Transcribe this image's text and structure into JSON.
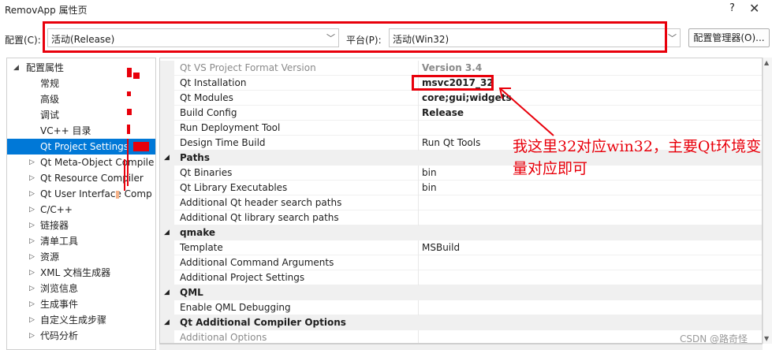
{
  "window": {
    "title": "RemovApp 属性页",
    "help": "?",
    "close": "✕"
  },
  "config_bar": {
    "config_label": "配置(C):",
    "config_value": "活动(Release)",
    "platform_label": "平台(P):",
    "platform_value": "活动(Win32)",
    "manager_button": "配置管理器(O)..."
  },
  "tree": {
    "root_label": "配置属性",
    "items": [
      {
        "label": "常规",
        "expandable": false
      },
      {
        "label": "高级",
        "expandable": false
      },
      {
        "label": "调试",
        "expandable": false
      },
      {
        "label": "VC++ 目录",
        "expandable": false
      },
      {
        "label": "Qt Project Settings",
        "expandable": false,
        "selected": true
      },
      {
        "label": "Qt Meta-Object Compile",
        "expandable": true
      },
      {
        "label": "Qt Resource Compiler",
        "expandable": true
      },
      {
        "label": "Qt User Interface Comp",
        "expandable": true
      },
      {
        "label": "C/C++",
        "expandable": true
      },
      {
        "label": "链接器",
        "expandable": true
      },
      {
        "label": "清单工具",
        "expandable": true
      },
      {
        "label": "资源",
        "expandable": true
      },
      {
        "label": "XML 文档生成器",
        "expandable": true
      },
      {
        "label": "浏览信息",
        "expandable": true
      },
      {
        "label": "生成事件",
        "expandable": true
      },
      {
        "label": "自定义生成步骤",
        "expandable": true
      },
      {
        "label": "代码分析",
        "expandable": true
      }
    ]
  },
  "grid": {
    "rows": [
      {
        "type": "prop",
        "name": "Qt VS Project Format Version",
        "value": "Version 3.4",
        "bold": true,
        "dim": true
      },
      {
        "type": "prop",
        "name": "Qt Installation",
        "value": "msvc2017_32",
        "bold": true
      },
      {
        "type": "prop",
        "name": "Qt Modules",
        "value": "core;gui;widgets",
        "bold": true
      },
      {
        "type": "prop",
        "name": "Build Config",
        "value": "Release",
        "bold": true
      },
      {
        "type": "prop",
        "name": "Run Deployment Tool",
        "value": ""
      },
      {
        "type": "prop",
        "name": "Design Time Build",
        "value": "Run Qt Tools"
      },
      {
        "type": "cat",
        "name": "Paths"
      },
      {
        "type": "prop",
        "name": "Qt Binaries",
        "value": "bin"
      },
      {
        "type": "prop",
        "name": "Qt Library Executables",
        "value": "bin"
      },
      {
        "type": "prop",
        "name": "Additional Qt header search paths",
        "value": ""
      },
      {
        "type": "prop",
        "name": "Additional Qt library search paths",
        "value": ""
      },
      {
        "type": "cat",
        "name": "qmake"
      },
      {
        "type": "prop",
        "name": "Template",
        "value": "MSBuild"
      },
      {
        "type": "prop",
        "name": "Additional Command Arguments",
        "value": ""
      },
      {
        "type": "prop",
        "name": "Additional Project Settings",
        "value": ""
      },
      {
        "type": "cat",
        "name": "QML"
      },
      {
        "type": "prop",
        "name": "Enable QML Debugging",
        "value": ""
      },
      {
        "type": "cat",
        "name": "Qt Additional Compiler Options"
      },
      {
        "type": "prop",
        "name": "Additional Options",
        "value": "",
        "dim": true
      }
    ]
  },
  "annotation": {
    "text": "我这里32对应win32，主要Qt环境变量对应即可",
    "color": "#e8000b"
  },
  "watermark": "CSDN @路奇怪",
  "colors": {
    "selection": "#0078d7",
    "highlight": "#e8000b"
  }
}
